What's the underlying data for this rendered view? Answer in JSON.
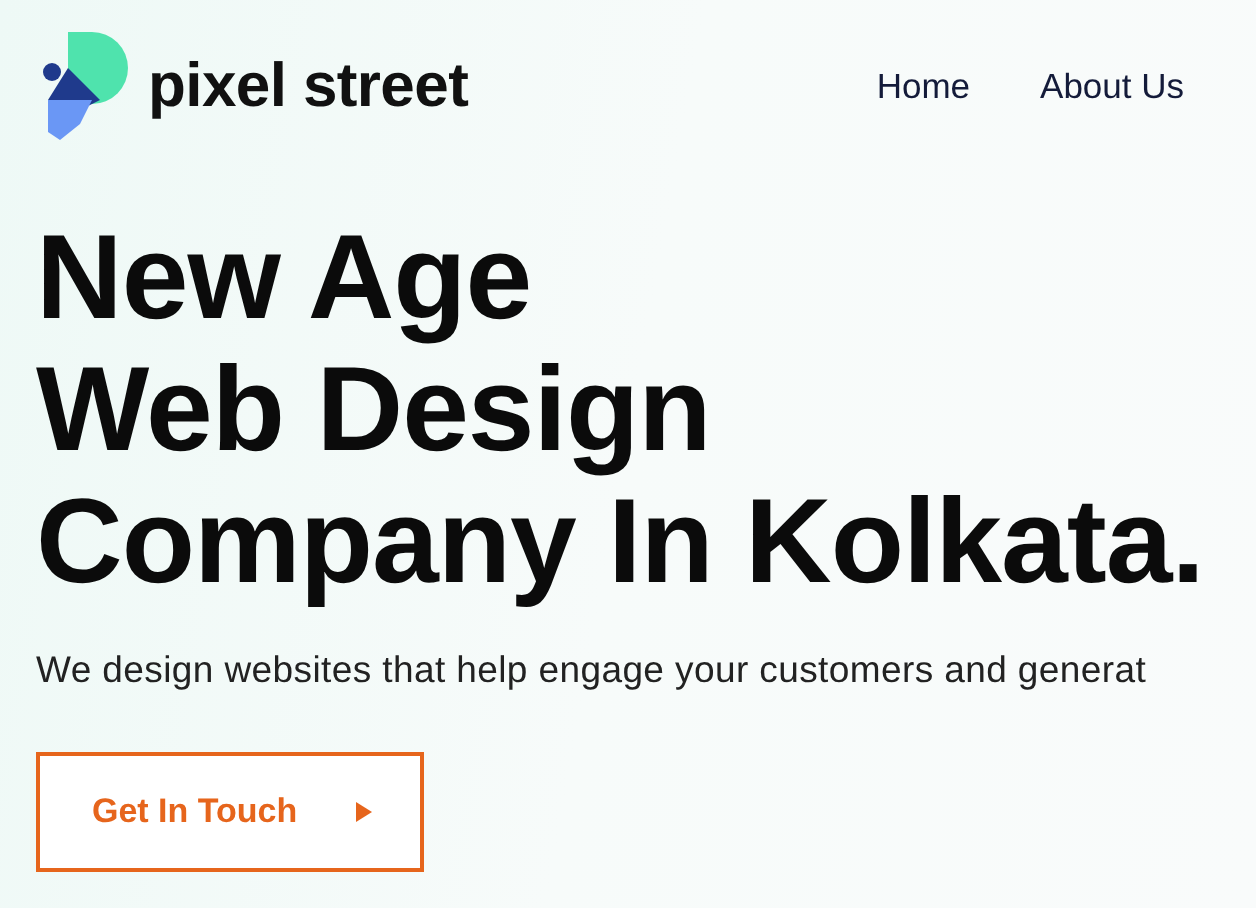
{
  "brand": {
    "name": "pixel street"
  },
  "nav": [
    {
      "label": "Home"
    },
    {
      "label": "About Us"
    }
  ],
  "hero": {
    "heading": [
      "New Age",
      "Web Design",
      "Company In Kolkata."
    ],
    "subtitle": "We design websites that help engage your customers and generat",
    "button": "Get In Touch"
  }
}
